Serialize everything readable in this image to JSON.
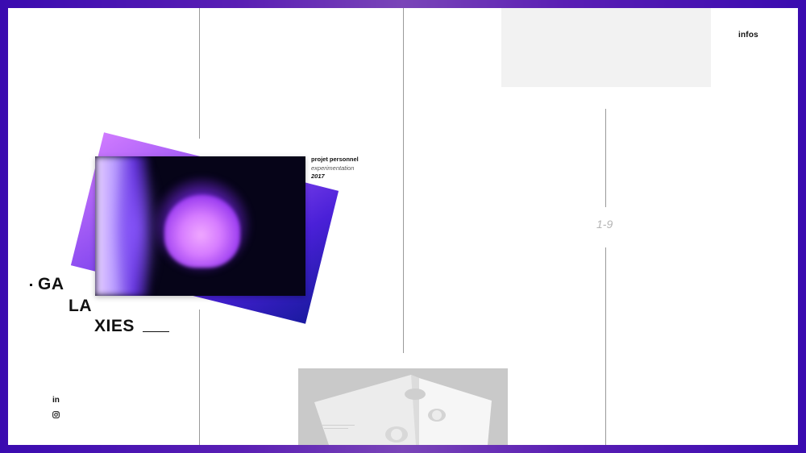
{
  "nav": {
    "infos_label": "infos"
  },
  "project": {
    "title_lines": [
      "GA",
      "LA",
      "XIES"
    ],
    "category": "projet personnel",
    "type": "experimentation",
    "year": "2017"
  },
  "pager": {
    "text": "1-9"
  },
  "social": {
    "linkedin_label": "in",
    "instagram": "instagram-icon"
  },
  "colors": {
    "frame_gradient_start": "#3a0bb0",
    "frame_gradient_mid": "#7a45b8",
    "accent_violet": "#8a4bf0",
    "text": "#111111",
    "muted": "#b5b5b5",
    "panel_gray": "#f2f2f2"
  }
}
